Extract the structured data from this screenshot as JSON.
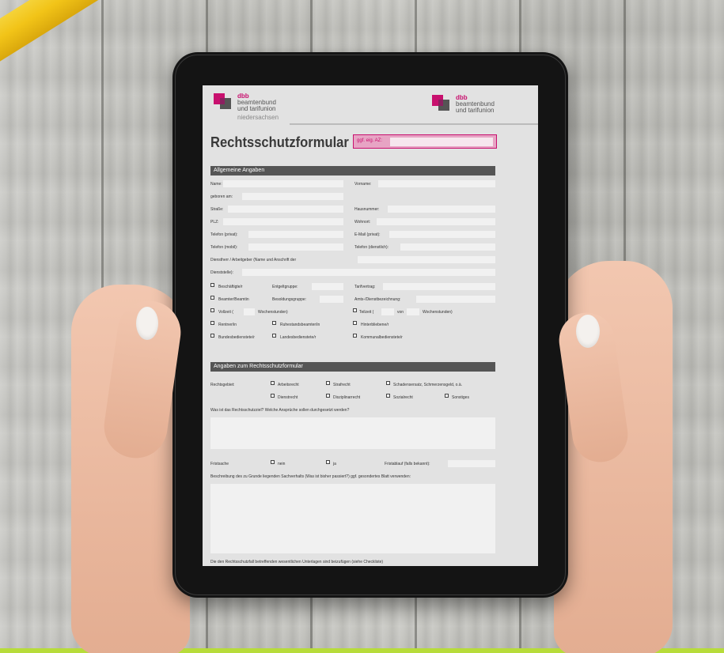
{
  "form": {
    "title": "Rechtsschutzformular",
    "az_label": "ggf. eig. AZ:",
    "logos": {
      "left": {
        "line1": "dbb",
        "line2": "beamtenbund",
        "line3": "und tarifunion",
        "line4": "niedersachsen"
      },
      "right": {
        "line1": "dbb",
        "line2": "beamtenbund",
        "line3": "und tarifunion"
      }
    },
    "section1": {
      "title": "Allgemeine Angaben",
      "fields": {
        "name": "Name:",
        "vorname": "Vorname:",
        "geboren": "geboren am:",
        "strasse": "Straße:",
        "hausnummer": "Hausnummer:",
        "plz": "PLZ:",
        "wohnort": "Wohnort:",
        "telefon_privat": "Telefon (privat):",
        "email": "E-Mail (privat):",
        "telefon_mobil": "Telefon (mobil):",
        "telefon_dienst": "Telefon (dienstlich):",
        "dienstherr": "Dienstherr / Arbeitgeber (Name und Anschrift der",
        "dienststelle": "Dienststelle):",
        "beschaeftigte": "Beschäftigte/r",
        "entgeltgruppe": "Entgeltgruppe:",
        "tarifvertrag": "Tarifvertrag:",
        "beamter": "Beamter/Beamtin",
        "besoldungsgruppe": "Besoldungsgruppe:",
        "amtsbezeichnung": "Amts-/Dienstbezeichnung:",
        "vollzeit": "Vollzeit (",
        "wochenstunden1": "Wochenstunden)",
        "teilzeit": "Teilzeit (",
        "von": "von",
        "wochenstunden2": "Wochenstunden)",
        "rentner": "Rentner/in",
        "ruhestand": "Ruhestandsbeamter/in",
        "hinterbliebene": "Hinterbliebene/r",
        "bundesbedienstete": "Bundesbedienstete/r",
        "landesbedienstete": "Landesbedienstete/r",
        "kommunalbedienstete": "Kommunalbedienstete/r"
      }
    },
    "section2": {
      "title": "Angaben zum Rechtsschutzformular",
      "rechtsgebiet": "Rechtsgebiet:",
      "options": {
        "arbeitsrecht": "Arbeitsrecht",
        "strafrecht": "Strafrecht",
        "schadensersatz": "Schadensersatz, Schmerzensgeld, o.ä.",
        "dienstrecht": "Dienstrecht",
        "disziplinarrecht": "Disziplinarrecht",
        "sozialrecht": "Sozialrecht",
        "sonstiges": "Sonstiges"
      },
      "frage_ziel": "Was ist das Rechtsschutzziel? Welche Ansprüche sollen durchgesetzt werden?",
      "fristsache": "Fristsache",
      "nein": "nein",
      "ja": "ja",
      "fristablauf": "Fristablauf (falls bekannt):",
      "beschreibung": "Beschreibung des zu Grunde liegenden Sachverhalts (Was ist bisher passiert?) ggf. gesondertes Blatt verwenden:",
      "footer": "Die den Rechtsschutzfall betreffenden wesentlichen Unterlagen sind beizufügen (siehe Checkliste)"
    }
  }
}
